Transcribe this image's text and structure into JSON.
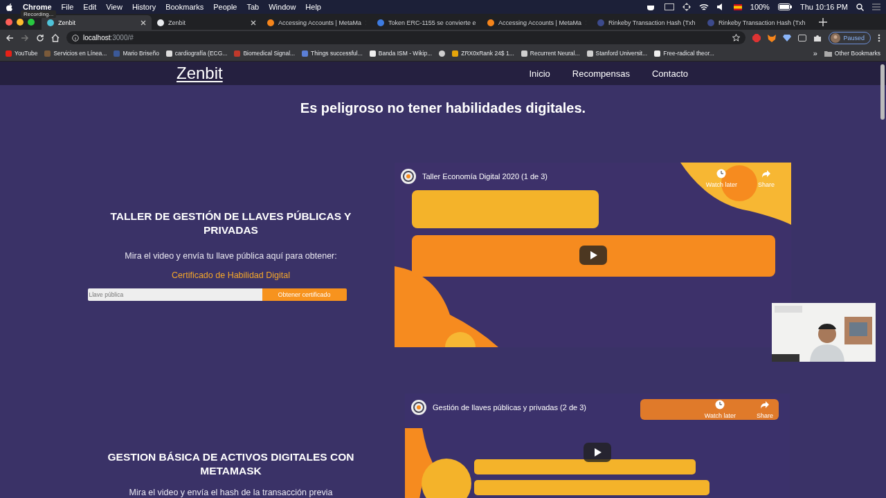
{
  "recording": "Recording...",
  "menu_bar": {
    "app": "Chrome",
    "menus": [
      "File",
      "Edit",
      "View",
      "History",
      "Bookmarks",
      "People",
      "Tab",
      "Window",
      "Help"
    ],
    "battery": "100%",
    "clock": "Thu 10:16 PM"
  },
  "tabs": [
    {
      "title": "Zenbit",
      "selected": true,
      "color": "#4fc3d9"
    },
    {
      "title": "Zenbit",
      "selected": false,
      "color": "#e8eaed"
    },
    {
      "title": "Accessing Accounts | MetaMa",
      "selected": false,
      "color": "#f6851b"
    },
    {
      "title": "Token ERC-1155 se convierte e",
      "selected": false,
      "color": "#3d7be0"
    },
    {
      "title": "Accessing Accounts | MetaMa",
      "selected": false,
      "color": "#f6851b"
    },
    {
      "title": "Rinkeby Transaction Hash (Txh",
      "selected": false,
      "color": "#3c4a8c"
    },
    {
      "title": "Rinkeby Transaction Hash (Txh",
      "selected": false,
      "color": "#3c4a8c"
    }
  ],
  "address_bar": {
    "host": "localhost",
    "path": ":3000/#"
  },
  "profile": "Paused",
  "bookmarks": [
    {
      "label": "YouTube",
      "color": "#e62117"
    },
    {
      "label": "Servicios en Línea...",
      "color": "#7a5a3a"
    },
    {
      "label": "Mario Briseño",
      "color": "#3b5998"
    },
    {
      "label": "cardiografía (ECG...",
      "color": "#dddddd"
    },
    {
      "label": "Biomedical Signal...",
      "color": "#c0392b"
    },
    {
      "label": "Things successful...",
      "color": "#5b7fd6"
    },
    {
      "label": "Banda ISM - Wikip...",
      "color": "#eeeeee"
    },
    {
      "color": "#cfcfcf"
    },
    {
      "label": "ZRX0xRank 24$ 1...",
      "color": "#e5a50a"
    },
    {
      "label": "Recurrent Neural...",
      "color": "#cfcfcf"
    },
    {
      "label": "Stanford Universit...",
      "color": "#cfcfcf"
    },
    {
      "label": "Free-radical theor...",
      "color": "#eeeeee"
    }
  ],
  "bookmarks_more": "»",
  "other_bookmarks": "Other Bookmarks",
  "site": {
    "logo": "Zenbit",
    "nav": [
      "Inicio",
      "Recompensas",
      "Contacto"
    ],
    "headline": "Es peligroso no tener habilidades digitales.",
    "sections": [
      {
        "title": "TALLER DE GESTIÓN DE LLAVES PÚBLICAS Y PRIVADAS",
        "text": "Mira el video y envía tu llave pública aquí para obtener:",
        "highlight": "Certificado de Habilidad Digital",
        "input": {
          "placeholder": "Llave pública"
        },
        "button": "Obtener certificado",
        "video": {
          "title": "Taller Economía Digital 2020 (1 de 3)",
          "watch_later": "Watch later",
          "share": "Share",
          "kind": "blobs"
        }
      },
      {
        "title": "GESTION BÁSICA DE ACTIVOS DIGITALES CON METAMASK",
        "text": "Mira el video y envía el hash de la transacción previa",
        "video": {
          "title": "Gestión de llaves públicas y privadas (2 de 3)",
          "watch_later": "Watch later",
          "share": "Share",
          "kind": "band"
        }
      }
    ]
  }
}
